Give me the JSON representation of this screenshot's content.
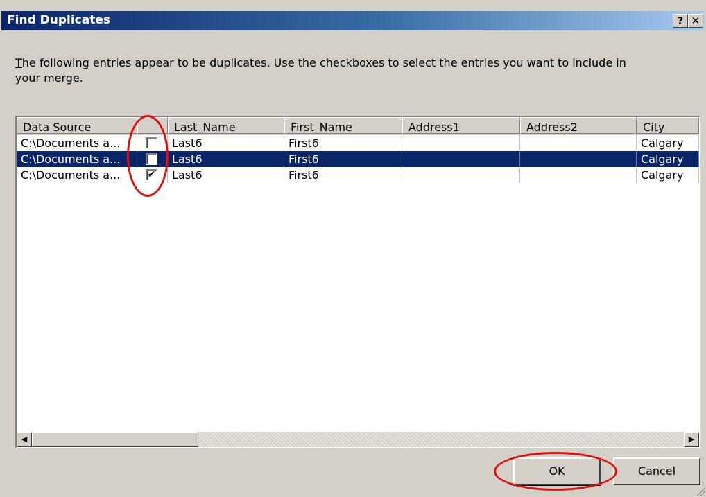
{
  "window": {
    "title": "Find Duplicates",
    "help_label": "?",
    "close_label": "✕"
  },
  "description": {
    "first_letter": "T",
    "text": "he following entries appear to be duplicates. Use the checkboxes to select the entries you want to include in your merge."
  },
  "columns": [
    "Data Source",
    "",
    "Last_Name",
    "First_Name",
    "Address1",
    "Address2",
    "City"
  ],
  "rows": [
    {
      "data_source": "C:\\Documents a...",
      "checked": false,
      "last_name": "Last6",
      "first_name": "First6",
      "address1": "",
      "address2": "",
      "city": "Calgary",
      "selected": false
    },
    {
      "data_source": "C:\\Documents a...",
      "checked": false,
      "last_name": "Last6",
      "first_name": "First6",
      "address1": "",
      "address2": "",
      "city": "Calgary",
      "selected": true
    },
    {
      "data_source": "C:\\Documents a...",
      "checked": true,
      "last_name": "Last6",
      "first_name": "First6",
      "address1": "",
      "address2": "",
      "city": "Calgary",
      "selected": false
    }
  ],
  "check_glyph": "✔",
  "scroll": {
    "left_glyph": "◀",
    "right_glyph": "▶"
  },
  "buttons": {
    "ok": "OK",
    "cancel": "Cancel"
  },
  "colors": {
    "titlebar_start": "#0a246a",
    "selection": "#0a246a",
    "annotation": "#e01010",
    "dialog_bg": "#d4d0c8"
  }
}
